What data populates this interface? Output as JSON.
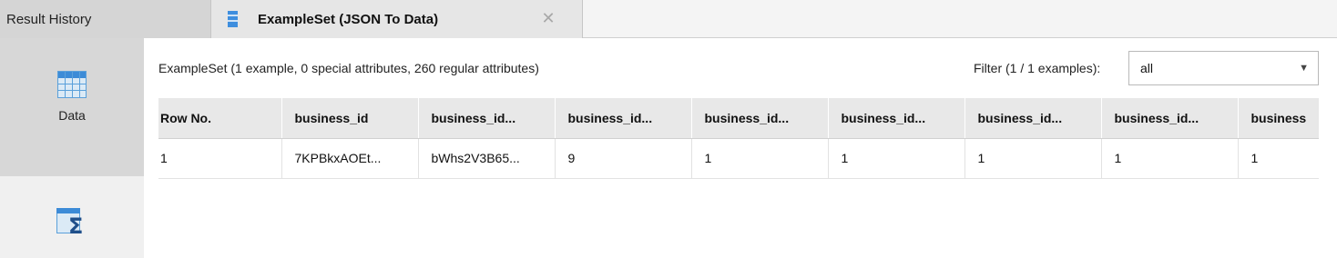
{
  "tabs": {
    "history_label": "Result History",
    "active_label": "ExampleSet (JSON To Data)",
    "close_glyph": "✕",
    "active_icon": "exampleset-icon"
  },
  "side_views": {
    "data_label": "Data",
    "data_icon": "data-table-icon",
    "statistics_icon": "statistics-icon",
    "statistics_glyph": "Σ"
  },
  "summary": {
    "text": "ExampleSet (1 example, 0 special attributes, 260 regular attributes)"
  },
  "filter": {
    "label": "Filter (1 / 1 examples):",
    "selected": "all",
    "caret": "▼"
  },
  "table": {
    "columns": [
      "Row No.",
      "business_id",
      "business_id...",
      "business_id...",
      "business_id...",
      "business_id...",
      "business_id...",
      "business_id...",
      "business"
    ],
    "rows": [
      [
        "1",
        "7KPBkxAOEt...",
        "bWhs2V3B65...",
        "9",
        "1",
        "1",
        "1",
        "1",
        "1"
      ]
    ]
  },
  "colors": {
    "accent": "#3c8bd7",
    "selected_side": "#d7d7d7",
    "header_bg": "#e8e8e8"
  }
}
